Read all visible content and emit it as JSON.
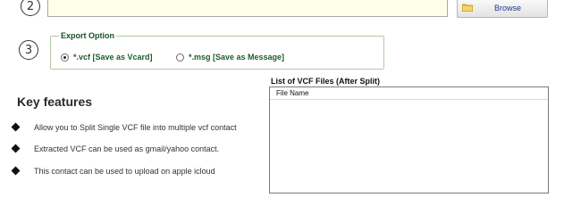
{
  "step2": {
    "number": "2",
    "path_value": ""
  },
  "browse": {
    "label": "Browse"
  },
  "step3": {
    "number": "3"
  },
  "export": {
    "legend": "Export Option",
    "options": [
      {
        "label": "*.vcf [Save as Vcard]",
        "selected": true
      },
      {
        "label": "*.msg [Save as Message]",
        "selected": false
      }
    ]
  },
  "features": {
    "title": "Key features",
    "items": [
      "Allow you to Split Single VCF file into multiple vcf contact",
      "Extracted VCF can be used as gmail/yahoo contact.",
      "This contact can be used to upload on apple icloud"
    ]
  },
  "file_list": {
    "title": "List of VCF Files (After Split)",
    "column_header": "File Name"
  },
  "colors": {
    "input_bg": "#fffee6",
    "accent_green": "#1a5e2a",
    "link_blue": "#1f3a8a"
  }
}
